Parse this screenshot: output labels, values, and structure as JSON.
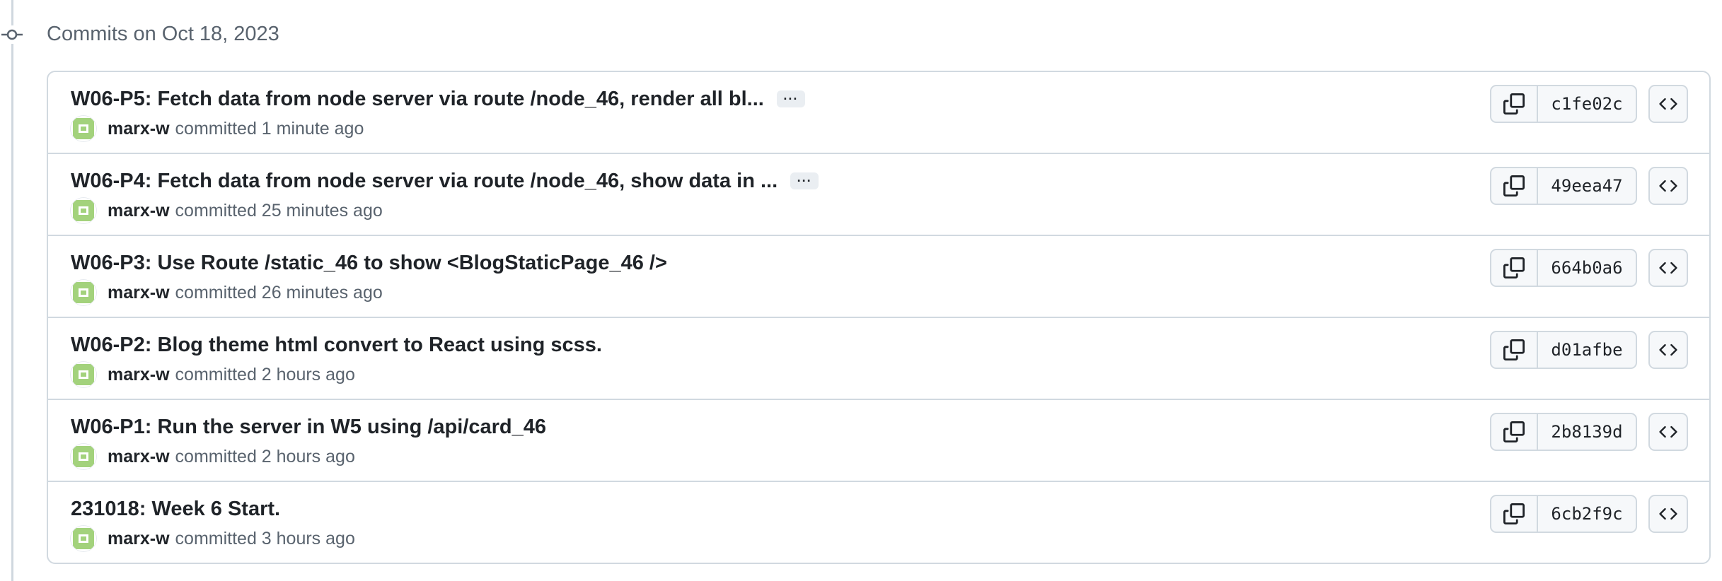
{
  "commit_group": {
    "heading": "Commits on Oct 18, 2023"
  },
  "commits": [
    {
      "title": "W06-P5: Fetch data from node server via route /node_46, render all bl...",
      "has_more": true,
      "author": "marx-w",
      "meta": "committed 1 minute ago",
      "sha": "c1fe02c"
    },
    {
      "title": "W06-P4: Fetch data from node server via route /node_46, show data in ...",
      "has_more": true,
      "author": "marx-w",
      "meta": "committed 25 minutes ago",
      "sha": "49eea47"
    },
    {
      "title": "W06-P3: Use Route /static_46 to show <BlogStaticPage_46 />",
      "has_more": false,
      "author": "marx-w",
      "meta": "committed 26 minutes ago",
      "sha": "664b0a6"
    },
    {
      "title": "W06-P2: Blog theme html convert to React using scss.",
      "has_more": false,
      "author": "marx-w",
      "meta": "committed 2 hours ago",
      "sha": "d01afbe"
    },
    {
      "title": "W06-P1: Run the server in W5 using /api/card_46",
      "has_more": false,
      "author": "marx-w",
      "meta": "committed 2 hours ago",
      "sha": "2b8139d"
    },
    {
      "title": "231018: Week 6 Start.",
      "has_more": false,
      "author": "marx-w",
      "meta": "committed 3 hours ago",
      "sha": "6cb2f9c"
    }
  ],
  "labels": {
    "ellipsis": "···"
  },
  "icons": {
    "timeline": "git-commit-icon",
    "avatar": "identicon-avatar",
    "copy": "copy-icon",
    "browse": "code-icon"
  },
  "colors": {
    "avatar_green": "#a3d27c",
    "border": "#d1d9e0",
    "muted_text": "#59636e"
  }
}
